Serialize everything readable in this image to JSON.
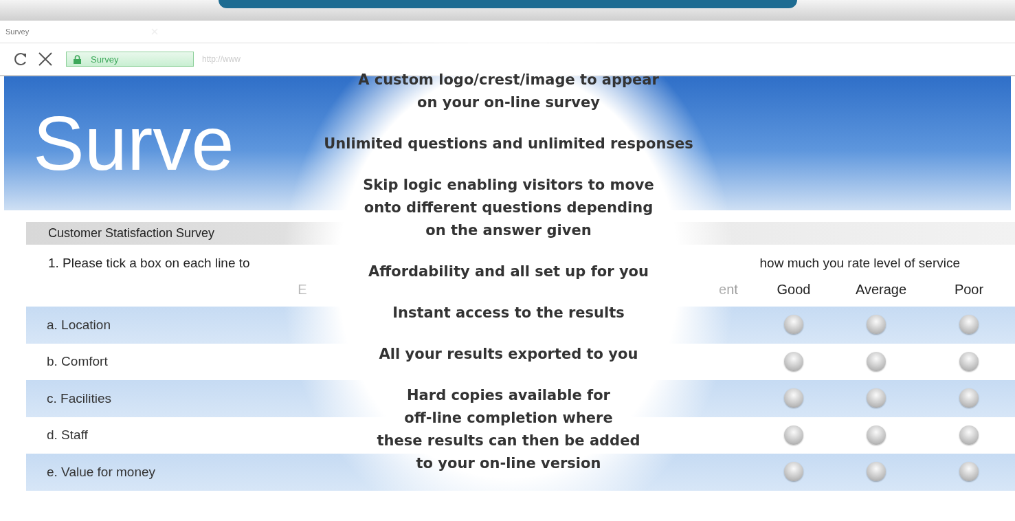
{
  "browser": {
    "tab_title": "Survey",
    "address_label": "Survey",
    "url": "http://www"
  },
  "header": {
    "title": "Surve"
  },
  "survey": {
    "title": "Customer Statisfaction Survey",
    "question_start": "1. Please tick a box on each line to",
    "question_end": "how much you rate level of service",
    "columns": [
      {
        "label": "E",
        "faded": true
      },
      {
        "label": "ent",
        "faded": true
      },
      {
        "label": "Good",
        "faded": false
      },
      {
        "label": "Average",
        "faded": false
      },
      {
        "label": "Poor",
        "faded": false
      }
    ],
    "rows": [
      {
        "label": "a. Location",
        "options": [
          {
            "selected": false
          },
          {
            "selected": false
          },
          {
            "selected": false
          }
        ]
      },
      {
        "label": "b. Comfort",
        "options": [
          {
            "selected": false
          },
          {
            "selected": false
          },
          {
            "selected": false
          }
        ]
      },
      {
        "label": "c. Facilities",
        "options": [
          {
            "selected": false
          },
          {
            "selected": false
          },
          {
            "selected": false
          }
        ]
      },
      {
        "label": "d. Staff",
        "options": [
          {
            "selected": false
          },
          {
            "selected": false
          },
          {
            "selected": false
          }
        ]
      },
      {
        "label": "e. Value for money",
        "options": [
          {
            "selected": false
          },
          {
            "selected": false
          },
          {
            "selected": false
          }
        ]
      }
    ]
  },
  "features": [
    [
      "A custom logo/crest/image to appear",
      "on your on-line survey"
    ],
    [
      "Unlimited questions and unlimited responses"
    ],
    [
      "Skip logic enabling visitors to move",
      "onto different questions depending",
      "on the answer given"
    ],
    [
      "Affordability and all set up for you"
    ],
    [
      "Instant access to the results"
    ],
    [
      "All your results exported to you"
    ],
    [
      "Hard copies available for",
      "off-line completion where",
      "these results can then be added",
      "to your on-line version"
    ]
  ]
}
